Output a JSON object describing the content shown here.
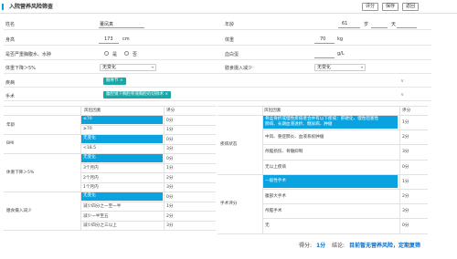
{
  "header": {
    "title": "入院营养风险筛查",
    "buttons": [
      "评分",
      "保存",
      "返回"
    ]
  },
  "form": {
    "name_label": "姓名",
    "name_value": "董凤真",
    "age_label": "年龄",
    "age_years": "61",
    "age_year_unit": "岁",
    "age_days_unit": "天",
    "height_label": "身高",
    "height_value": "173",
    "height_unit": "cm",
    "weight_label": "体重",
    "weight_value": "70",
    "weight_unit": "kg",
    "edema_label": "是否严重胸腹水、水肿",
    "edema_yes": "是",
    "edema_no": "否",
    "albumin_label": "血白蛋",
    "albumin_unit": "g/L",
    "weight_loss_label": "体重下降＞5%",
    "weight_loss_value": "无变化",
    "intake_label": "膳食摄入减少",
    "intake_value": "无变化",
    "disease_label": "疾病",
    "disease_tag": "髋骨节 ×",
    "surgery_label": "手术",
    "surgery_tag": "腹腔镜下胸腔积液胸腔的切除术 ×"
  },
  "left_table": {
    "header_factor": "风险因素",
    "header_score": "评分",
    "groups": [
      {
        "name": "年龄",
        "rows": [
          {
            "factor": "≤70",
            "score": "0分",
            "selected": true
          },
          {
            "factor": "≥70",
            "score": "1分",
            "selected": false
          }
        ]
      },
      {
        "name": "BMI",
        "rows": [
          {
            "factor": "无变化",
            "score": "0分",
            "selected": true
          },
          {
            "factor": "<18.5",
            "score": "3分",
            "selected": false
          }
        ]
      },
      {
        "name": "体重下降＞5%",
        "rows": [
          {
            "factor": "无变化",
            "score": "0分",
            "selected": true
          },
          {
            "factor": "3个月内",
            "score": "1分",
            "selected": false
          },
          {
            "factor": "2个月内",
            "score": "2分",
            "selected": false
          },
          {
            "factor": "1个月内",
            "score": "3分",
            "selected": false
          }
        ]
      },
      {
        "name": "膳食摄入减少",
        "rows": [
          {
            "factor": "无变化",
            "score": "0分",
            "selected": true
          },
          {
            "factor": "减少四分之一至一半",
            "score": "1分",
            "selected": false
          },
          {
            "factor": "减少一半至五",
            "score": "2分",
            "selected": false
          },
          {
            "factor": "减少四分之三以上",
            "score": "3分",
            "selected": false
          }
        ]
      }
    ]
  },
  "right_table": {
    "header_factor": "风险因素",
    "header_score": "评分",
    "disease_group": "疾病状态",
    "disease_rows": [
      {
        "line1": "骨盆骨折或慢性疾病者合并有以下疾病：肝硬化、慢性阻塞性",
        "line2": "肺病、长期血液透析、糖尿病、肿瘤",
        "score": "1分",
        "selected": true
      },
      {
        "line1": "中风、重症肺炎、血液系统肿瘤",
        "score": "2分",
        "selected": false
      },
      {
        "line1": "颅脑损伤、骨髓抑制",
        "score": "3分",
        "selected": false
      },
      {
        "line1": "无以上疾病",
        "score": "0分",
        "selected": false
      }
    ],
    "surgery_group": "手术评分",
    "surgery_rows": [
      {
        "line1": "一般性手术",
        "score": "1分",
        "selected": true
      },
      {
        "line1": "腹部大手术",
        "score": "2分",
        "selected": false
      },
      {
        "line1": "颅脑手术",
        "score": "3分",
        "selected": false
      },
      {
        "line1": "无",
        "score": "0分",
        "selected": false
      }
    ]
  },
  "footer": {
    "score_label": "得分:",
    "score_value": "1分",
    "conclusion_label": "结论:",
    "conclusion_value": "目前暂无营养风险，定期复筛"
  },
  "colors": {
    "accent": "#0f9ed5",
    "highlight": "#0aa3e0",
    "tag": "#1aa7a7",
    "footer_text": "#0b6fc9"
  }
}
